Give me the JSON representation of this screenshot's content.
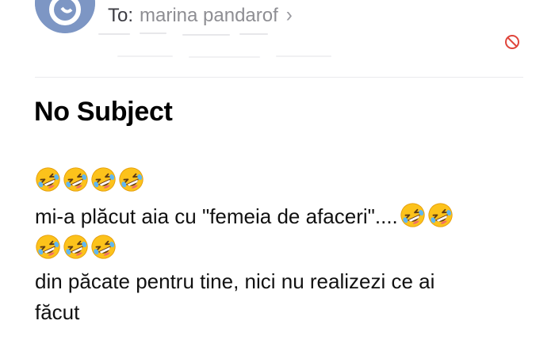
{
  "header": {
    "to_label": "To:",
    "recipient": "marina pandarof",
    "chevron": "›",
    "icons": {
      "avatar": "contact-avatar",
      "block": "block-sender-icon"
    },
    "accent_color": "#ff3b30"
  },
  "subject": "No Subject",
  "body": {
    "line1_emoji_count": 4,
    "line2_text": "mi-a plăcut aia cu \"femeia de afaceri\"....",
    "line2_trailing_emoji_count": 2,
    "line3_emoji_count": 3,
    "line4_text": "din păcate pentru tine, nici nu realizezi ce ai",
    "line5_text": "făcut",
    "emoji_name": "rolling-on-the-floor-laughing"
  }
}
